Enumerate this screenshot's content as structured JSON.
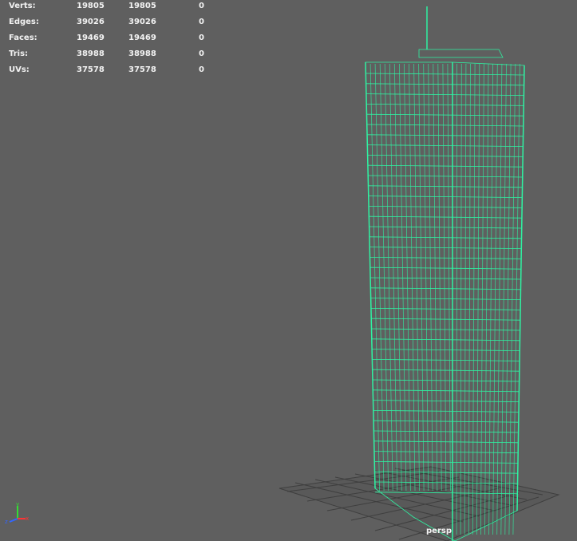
{
  "hud": {
    "rows": [
      {
        "label": "Verts:",
        "a": "19805",
        "b": "19805",
        "c": "0"
      },
      {
        "label": "Edges:",
        "a": "39026",
        "b": "39026",
        "c": "0"
      },
      {
        "label": "Faces:",
        "a": "19469",
        "b": "19469",
        "c": "0"
      },
      {
        "label": "Tris:",
        "a": "38988",
        "b": "38988",
        "c": "0"
      },
      {
        "label": "UVs:",
        "a": "37578",
        "b": "37578",
        "c": "0"
      }
    ]
  },
  "camera_label": "persp",
  "colors": {
    "background": "#5f5f5f",
    "wireframe": "#2ff2a2",
    "grid": "#4a4a4a"
  },
  "axis": {
    "y": "y",
    "x": "x",
    "z": "z"
  },
  "icons": {
    "axis_gizmo": "xyz-axis-gizmo-icon"
  }
}
